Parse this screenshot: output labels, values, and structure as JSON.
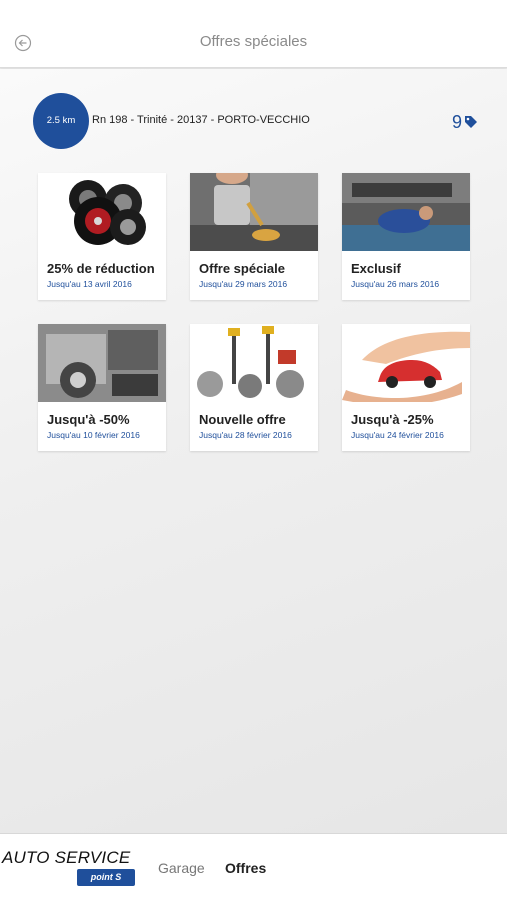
{
  "header": {
    "title": "Offres spéciales",
    "back_icon": "back-arrow-icon"
  },
  "location": {
    "distance": "2.5 km",
    "address": "Rn 198 - Trinité - 20137 - PORTO-VECCHIO",
    "offers_count": "9",
    "tag_icon": "tag-icon"
  },
  "offers": [
    {
      "title": "25% de réduction",
      "date": "Jusqu'au 13 avril 2016",
      "image": "tires"
    },
    {
      "title": "Offre spéciale",
      "date": "Jusqu'au 29 mars 2016",
      "image": "oil-change"
    },
    {
      "title": "Exclusif",
      "date": "Jusqu'au 26 mars 2016",
      "image": "mechanic"
    },
    {
      "title": "Jusqu'à -50%",
      "date": "Jusqu'au 10 février 2016",
      "image": "engine"
    },
    {
      "title": "Nouvelle offre",
      "date": "Jusqu'au 28 février 2016",
      "image": "brake-parts"
    },
    {
      "title": "Jusqu'à -25%",
      "date": "Jusqu'au 24 février 2016",
      "image": "car-in-hands"
    }
  ],
  "footer": {
    "brand_name": "AUTO SERVICE",
    "brand_badge": "point S",
    "nav": {
      "garage": "Garage",
      "offres": "Offres"
    }
  },
  "colors": {
    "accent": "#1f4f9b",
    "header_bg": "#ffffff",
    "content_bg": "#ececec"
  }
}
